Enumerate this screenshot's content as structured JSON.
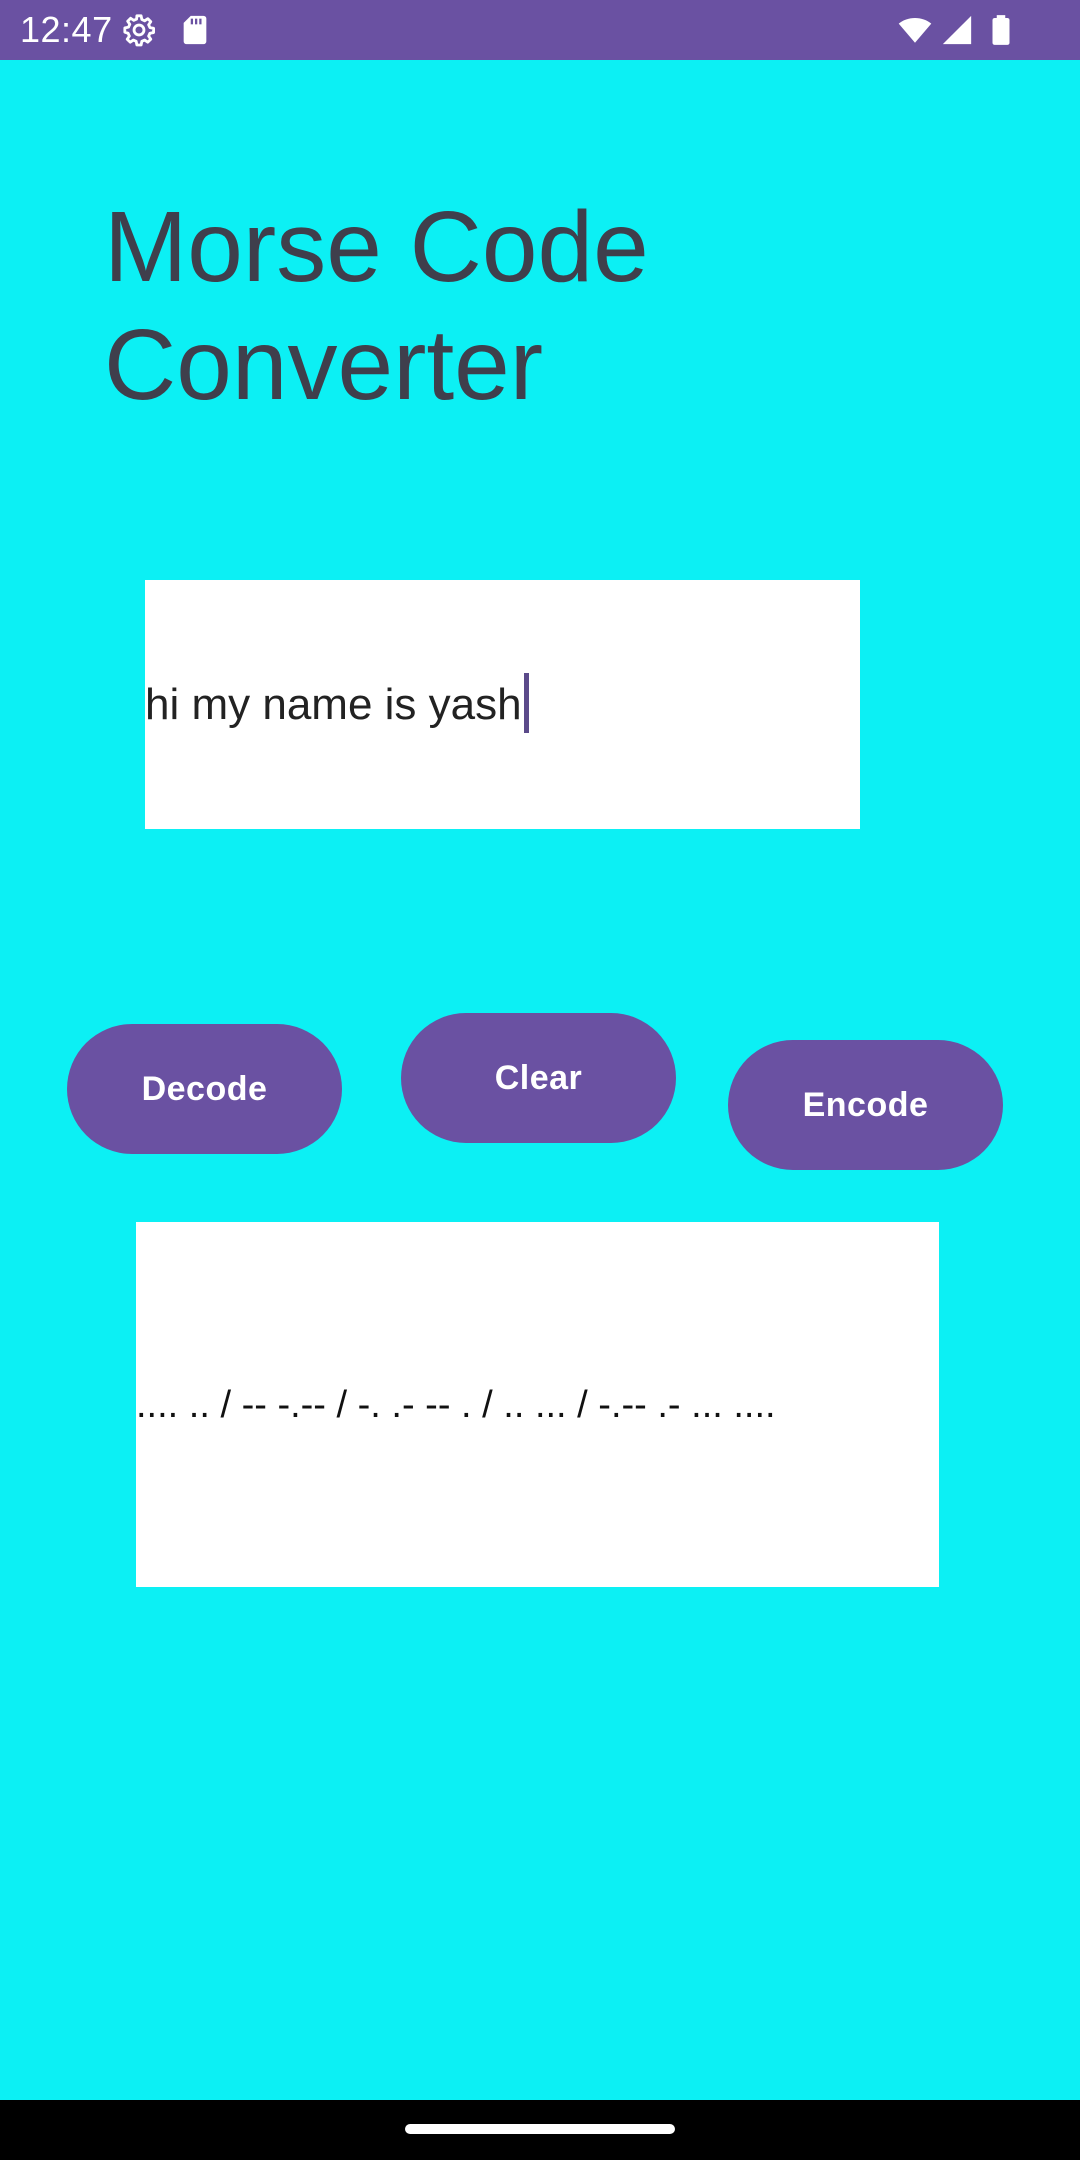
{
  "status_bar": {
    "time": "12:47",
    "icons": [
      "settings-gear-icon",
      "sd-card-icon",
      "wifi-icon",
      "signal-icon",
      "battery-icon"
    ],
    "background": "#6a51a2"
  },
  "app": {
    "background": "#0cf0f4",
    "title_line1": "Morse Code",
    "title_line2": "Converter",
    "title_color": "#3f3f4c"
  },
  "input": {
    "value": "hi my name is yash"
  },
  "buttons": {
    "decode_label": "Decode",
    "clear_label": "Clear",
    "encode_label": "Encode",
    "color": "#6a51a2"
  },
  "output": {
    "value": ".... .. / -- -.-- / -. .- -- . / .. ... / -.-- .- ... ...."
  },
  "nav_bar": {
    "home_indicator": "home-pill"
  }
}
